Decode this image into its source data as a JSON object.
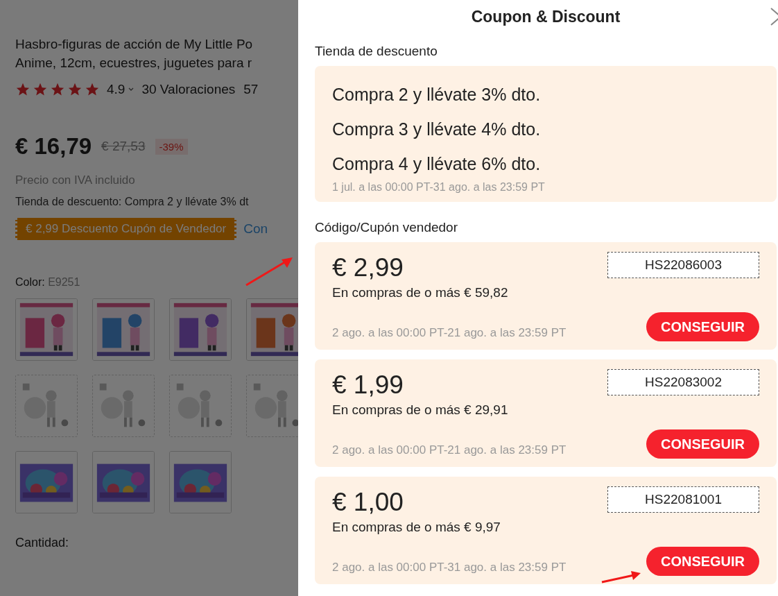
{
  "product_page": {
    "title_lines": [
      "Hasbro-figuras de acción de My Little Po",
      "Anime, 12cm, ecuestres, juguetes para r"
    ],
    "rating": {
      "stars": 5,
      "score": "4.9",
      "reviews": "30 Valoraciones",
      "sold": "57"
    },
    "price": "€ 16,79",
    "original_price": "€ 27,53",
    "discount": "-39%",
    "tax_note": "Precio con IVA incluido",
    "store_discount": "Tienda de descuento: Compra 2 y llévate 3% dt",
    "coupon_badge": "€ 2,99 Descuento Cupón de Vendedor",
    "coupon_link": "Con",
    "color_label": "Color:",
    "color_value": "E9251",
    "thumbnails": [
      {
        "kind": "picture",
        "dashed": false
      },
      {
        "kind": "picture",
        "dashed": false
      },
      {
        "kind": "picture",
        "dashed": false
      },
      {
        "kind": "picture",
        "dashed": false
      },
      {
        "kind": "picture",
        "dashed": true
      },
      {
        "kind": "picture",
        "dashed": true
      },
      {
        "kind": "picture",
        "dashed": true
      },
      {
        "kind": "picture",
        "dashed": true
      },
      {
        "kind": "picture",
        "dashed": false
      },
      {
        "kind": "picture",
        "dashed": false
      },
      {
        "kind": "picture",
        "dashed": false
      }
    ],
    "quantity_label": "Cantidad:"
  },
  "drawer": {
    "title": "Coupon & Discount",
    "store_section": {
      "heading": "Tienda de descuento",
      "offers": [
        "Compra 2 y llévate 3% dto.",
        "Compra 3 y llévate 4% dto.",
        "Compra 4 y llévate 6% dto."
      ],
      "validity": "1 jul. a las 00:00 PT-31 ago. a las 23:59 PT"
    },
    "coupon_section": {
      "heading": "Código/Cupón vendedor",
      "coupons": [
        {
          "amount": "€ 2,99",
          "condition": "En compras de o más € 59,82",
          "validity": "2 ago. a las 00:00 PT-21 ago. a las 23:59 PT",
          "code": "HS22086003",
          "button": "CONSEGUIR"
        },
        {
          "amount": "€ 1,99",
          "condition": "En compras de o más € 29,91",
          "validity": "2 ago. a las 00:00 PT-21 ago. a las 23:59 PT",
          "code": "HS22083002",
          "button": "CONSEGUIR"
        },
        {
          "amount": "€ 1,00",
          "condition": "En compras de o más € 9,97",
          "validity": "2 ago. a las 00:00 PT-31 ago. a las 23:59 PT",
          "code": "HS22081001",
          "button": "CONSEGUIR"
        }
      ]
    }
  }
}
